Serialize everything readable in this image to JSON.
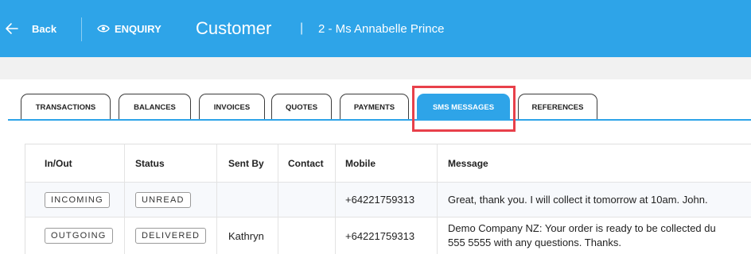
{
  "header": {
    "back_label": "Back",
    "mode_label": "ENQUIRY",
    "entity_title": "Customer",
    "separator": "|",
    "record_title": "2 - Ms Annabelle Prince",
    "color": "#2ea4e8"
  },
  "tabs": [
    {
      "label": "TRANSACTIONS",
      "active": false
    },
    {
      "label": "BALANCES",
      "active": false
    },
    {
      "label": "INVOICES",
      "active": false
    },
    {
      "label": "QUOTES",
      "active": false
    },
    {
      "label": "PAYMENTS",
      "active": false
    },
    {
      "label": "SMS MESSAGES",
      "active": true
    },
    {
      "label": "REFERENCES",
      "active": false
    }
  ],
  "table": {
    "columns": [
      "In/Out",
      "Status",
      "Sent By",
      "Contact",
      "Mobile",
      "Message"
    ],
    "rows": [
      {
        "in_out": "INCOMING",
        "status": "UNREAD",
        "sent_by": "",
        "contact": "",
        "mobile": "+64221759313",
        "message_line1": "Great, thank you. I will collect it tomorrow at 10am. John.",
        "message_line2": ""
      },
      {
        "in_out": "OUTGOING",
        "status": "DELIVERED",
        "sent_by": "Kathryn",
        "contact": "",
        "mobile": "+64221759313",
        "message_line1": "Demo Company NZ: Your order is ready to be collected du",
        "message_line2": "555 5555 with any questions. Thanks."
      }
    ]
  },
  "colors": {
    "accent": "#2ea4e8",
    "highlight": "#e8404a"
  }
}
